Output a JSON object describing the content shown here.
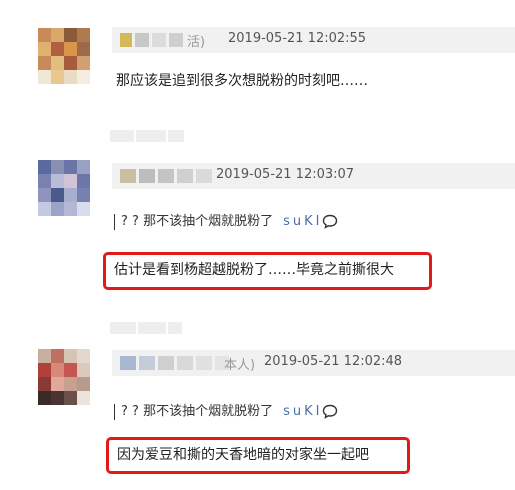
{
  "comments": [
    {
      "username_suffix": "活)",
      "timestamp": "2019-05-21 12:02:55",
      "text": "那应该是追到很多次想脱粉的时刻吧……"
    },
    {
      "timestamp": "2019-05-21 12:03:07",
      "quote": {
        "text": "? ? 那不该抽个烟就脱粉了",
        "author": "suKI"
      },
      "highlighted_text": "估计是看到杨超越脱粉了……毕竟之前撕很大"
    },
    {
      "username_suffix": "本人)",
      "timestamp": "2019-05-21 12:02:48",
      "quote": {
        "text": "? ? 那不该抽个烟就脱粉了",
        "author": "suKI"
      },
      "highlighted_text": "因为爱豆和撕的天香地暗的对家坐一起吧"
    }
  ],
  "colors": {
    "highlight_border": "#e11b1b",
    "quote_author": "#4a6ea9",
    "meta_bar": "#f1f1f1"
  },
  "icons": [
    "chat-bubble-icon"
  ]
}
